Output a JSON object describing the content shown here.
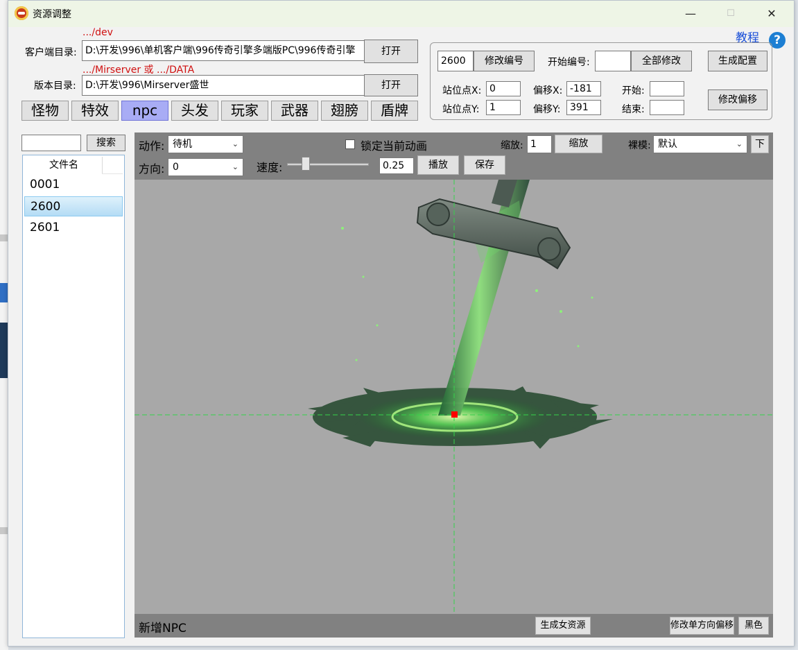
{
  "window": {
    "title": "资源调整",
    "minimize_glyph": "—",
    "maximize_glyph": "☐",
    "close_glyph": "✕",
    "icon": "app-logo-icon"
  },
  "client_dir": {
    "hint": ".../dev",
    "label": "客户端目录:",
    "value": "D:\\开发\\996\\单机客户端\\996传奇引擎多端版PC\\996传奇引擎",
    "open_label": "打开"
  },
  "server_dir": {
    "hint": ".../Mirserver 或 .../DATA",
    "label": "版本目录:",
    "value": "D:\\开发\\996\\Mirserver盛世",
    "open_label": "打开"
  },
  "tabs": [
    "怪物",
    "特效",
    "npc",
    "头发",
    "玩家",
    "武器",
    "翅膀",
    "盾牌"
  ],
  "active_tab": "npc",
  "help": {
    "label": "教程",
    "icon_text": "?"
  },
  "config_panel": {
    "id_value": "2600",
    "modify_id_label": "修改编号",
    "start_id_label": "开始编号:",
    "start_id_value": "",
    "modify_all_label": "全部修改",
    "generate_config_label": "生成配置",
    "stand_x_label": "站位点X:",
    "stand_x_value": "0",
    "stand_y_label": "站位点Y:",
    "stand_y_value": "1",
    "offset_x_label": "偏移X:",
    "offset_x_value": "-181",
    "offset_y_label": "偏移Y:",
    "offset_y_value": "391",
    "start_label": "开始:",
    "start_value": "",
    "end_label": "结束:",
    "end_value": "",
    "modify_offset_label": "修改偏移"
  },
  "search": {
    "value": "",
    "button_label": "搜索"
  },
  "file_list": {
    "header": "文件名",
    "items": [
      "0001",
      "2600",
      "2601"
    ],
    "selected": "2600"
  },
  "controls": {
    "action_label": "动作:",
    "action_value": "待机",
    "lock_label": "锁定当前动画",
    "lock_checked": false,
    "scale_label": "缩放:",
    "scale_value": "1",
    "scale_button": "缩放",
    "nude_label": "裸模:",
    "nude_value": "默认",
    "down_button": "下",
    "direction_label": "方向:",
    "direction_value": "0",
    "speed_label": "速度:",
    "speed_value": "0.25",
    "speed_fraction": 0.2,
    "play_label": "播放",
    "save_label": "保存"
  },
  "bottom_bar": {
    "title": "新增NPC",
    "generate_female_label": "生成女资源",
    "modify_dir_offset_label": "修改单方向偏移",
    "black_label": "黑色"
  },
  "colors": {
    "active_tab": "#a8acf5",
    "stage_bg": "#a8a8a8",
    "crosshair": "#35d24a",
    "anchor": "#ff0000",
    "hint_text": "#d01010",
    "link": "#1a4fd8"
  }
}
